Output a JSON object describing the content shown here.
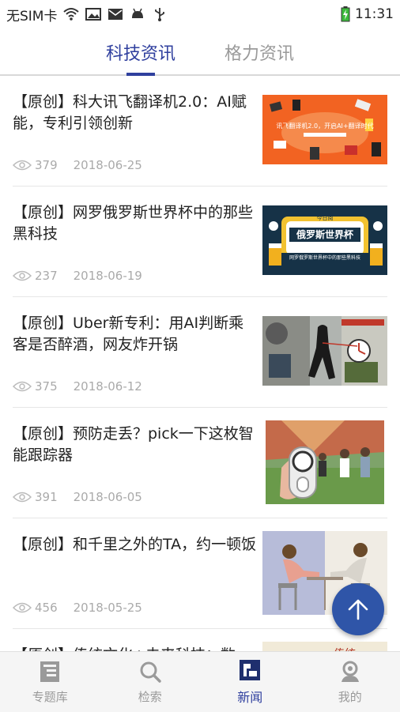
{
  "statusbar": {
    "carrier": "无SIM卡",
    "time": "11:31"
  },
  "tabs": [
    {
      "label": "科技资讯",
      "active": true
    },
    {
      "label": "格力资讯",
      "active": false
    }
  ],
  "articles": [
    {
      "title": "【原创】科大讯飞翻译机2.0：AI赋能，专利引领创新",
      "views": "379",
      "date": "2018-06-25"
    },
    {
      "title": "【原创】网罗俄罗斯世界杯中的那些黑科技",
      "views": "237",
      "date": "2018-06-19"
    },
    {
      "title": "【原创】Uber新专利：用AI判断乘客是否醉酒，网友炸开锅",
      "views": "375",
      "date": "2018-06-12"
    },
    {
      "title": "【原创】预防走丢？pick一下这枚智能跟踪器",
      "views": "391",
      "date": "2018-06-05"
    },
    {
      "title": "【原创】和千里之外的TA，约一顿饭",
      "views": "456",
      "date": "2018-05-25"
    },
    {
      "title": "【原创】传统文化+未来科技：数",
      "views": "",
      "date": ""
    }
  ],
  "thumbs": {
    "t1": "讯飞翻译机2.0，开启AI+翻译时代",
    "t2a": "今日阅",
    "t2b": "俄罗斯世界杯",
    "t2c": "网罗俄罗斯世界杯中的那些黑科技",
    "t6": "传统"
  },
  "nav": [
    {
      "label": "专题库",
      "icon": "topic-library-icon",
      "active": false
    },
    {
      "label": "检索",
      "icon": "search-icon",
      "active": false
    },
    {
      "label": "新闻",
      "icon": "news-icon",
      "active": true
    },
    {
      "label": "我的",
      "icon": "profile-icon",
      "active": false
    }
  ],
  "colors": {
    "accent": "#2f3f9e",
    "fab": "#2f55a8"
  }
}
